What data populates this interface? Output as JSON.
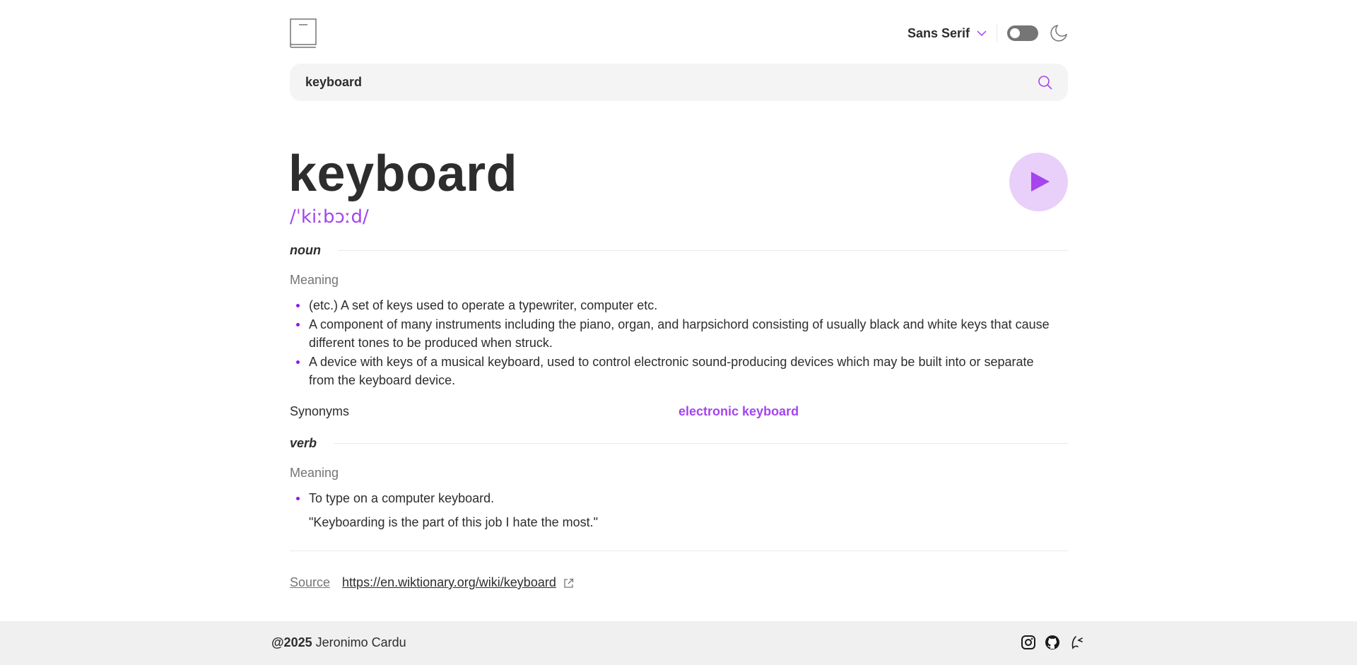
{
  "header": {
    "font_selected": "Sans Serif"
  },
  "search": {
    "value": "keyboard"
  },
  "entry": {
    "word": "keyboard",
    "phonetic": "/ˈkiːbɔːd/"
  },
  "meanings": [
    {
      "part_of_speech": "noun",
      "meaning_title": "Meaning",
      "definitions": [
        "(etc.) A set of keys used to operate a typewriter, computer etc.",
        "A component of many instruments including the piano, organ, and harpsichord consisting of usually black and white keys that cause different tones to be produced when struck.",
        "A device with keys of a musical keyboard, used to control electronic sound-producing devices which may be built into or separate from the keyboard device."
      ],
      "synonyms_label": "Synonyms",
      "synonyms": [
        "electronic keyboard"
      ]
    },
    {
      "part_of_speech": "verb",
      "meaning_title": "Meaning",
      "definitions": [
        "To type on a computer keyboard."
      ],
      "example": "\"Keyboarding is the part of this job I hate the most.\""
    }
  ],
  "source": {
    "label": "Source",
    "url": "https://en.wiktionary.org/wiki/keyboard"
  },
  "footer": {
    "year": "@2025",
    "author": "Jeronimo Cardu",
    "icons": [
      "instagram-icon",
      "github-icon",
      "portfolio-icon"
    ]
  },
  "colors": {
    "accent": "#a445ed",
    "accent_light": "#e8d0fa",
    "text": "#2d2d2d",
    "muted": "#757575"
  }
}
